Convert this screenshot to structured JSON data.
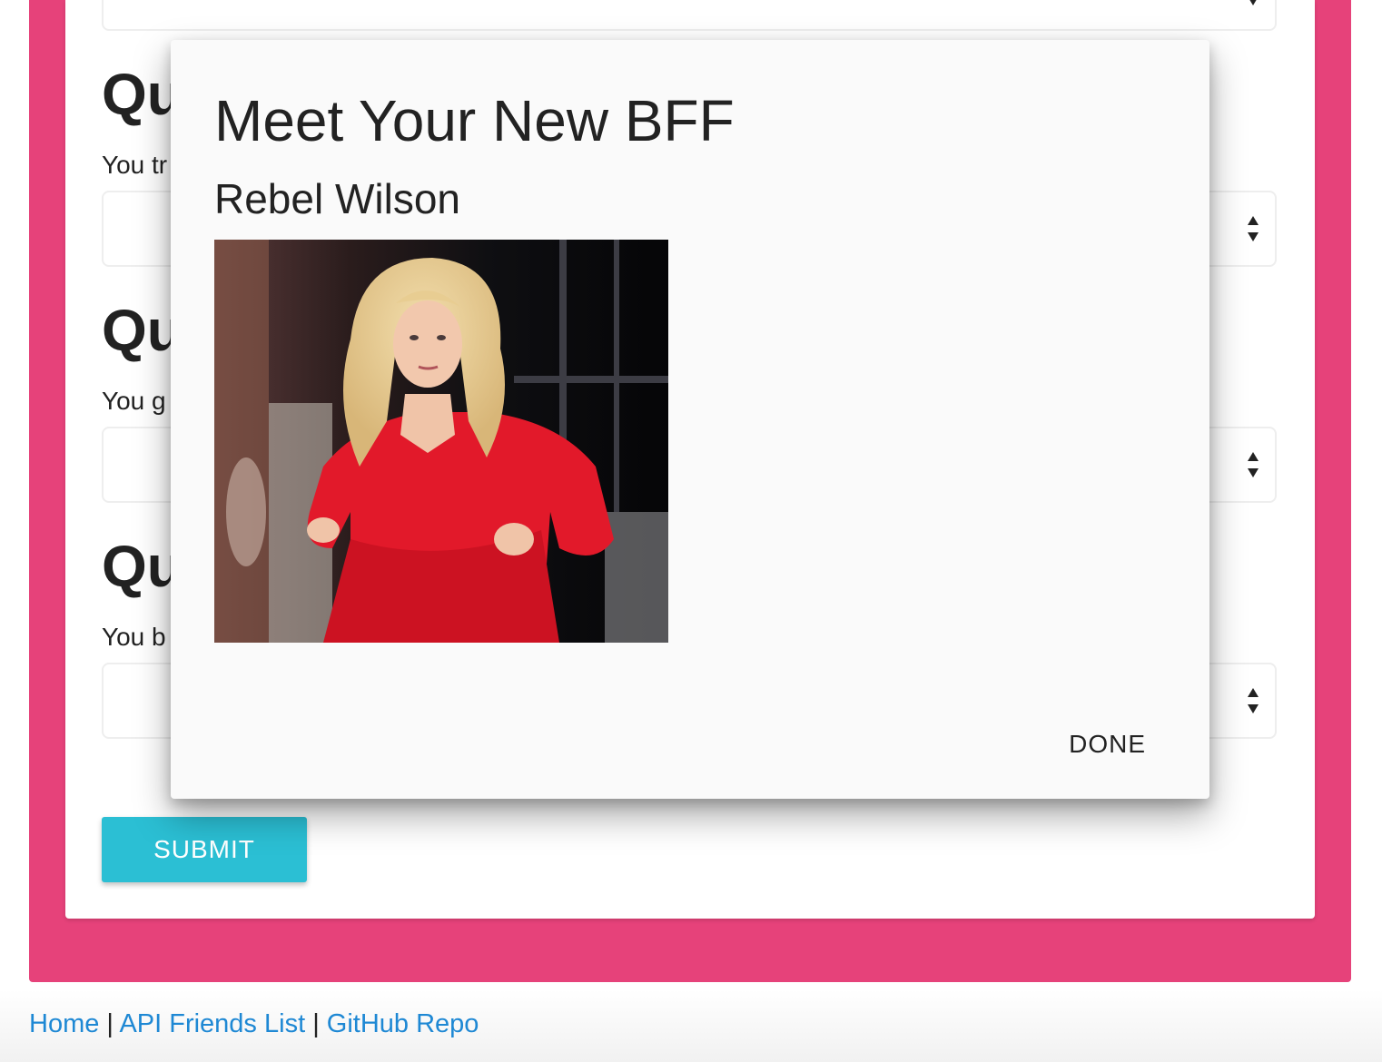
{
  "background_form": {
    "questions": [
      {
        "heading": "Qu",
        "text": "You tr"
      },
      {
        "heading": "Qu",
        "text": "You g"
      },
      {
        "heading": "Qu",
        "text": "You b"
      }
    ],
    "submit_label": "SUBMIT"
  },
  "modal": {
    "title": "Meet Your New BFF",
    "subtitle": "Rebel Wilson",
    "done_label": "DONE"
  },
  "footer": {
    "links": [
      "Home",
      "API Friends List",
      "GitHub Repo"
    ],
    "separator": "|"
  },
  "colors": {
    "frame_pink": "#e6427a",
    "submit_teal": "#2bbfd4",
    "link_blue": "#1e88d4"
  },
  "icons": [
    "select-arrows-icon"
  ]
}
